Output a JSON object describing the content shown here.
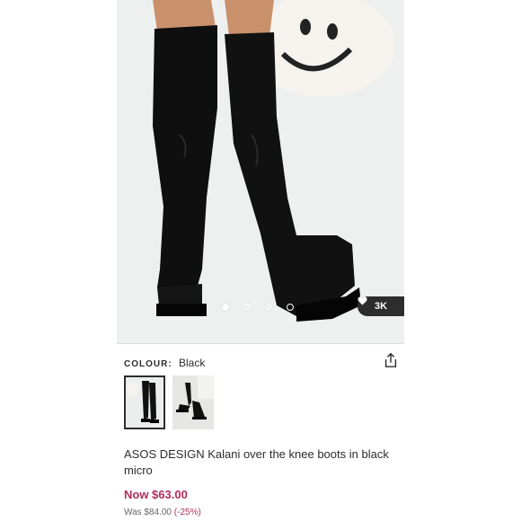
{
  "product": {
    "colour_label": "COLOUR:",
    "colour_value": "Black",
    "title": "ASOS DESIGN Kalani over the knee boots in black micro",
    "now_price": "Now $63.00",
    "was_price": "Was $84.00",
    "discount": "(-25%)"
  },
  "gallery": {
    "likes": "3K",
    "dot_count": 4,
    "active_dot": 1
  }
}
